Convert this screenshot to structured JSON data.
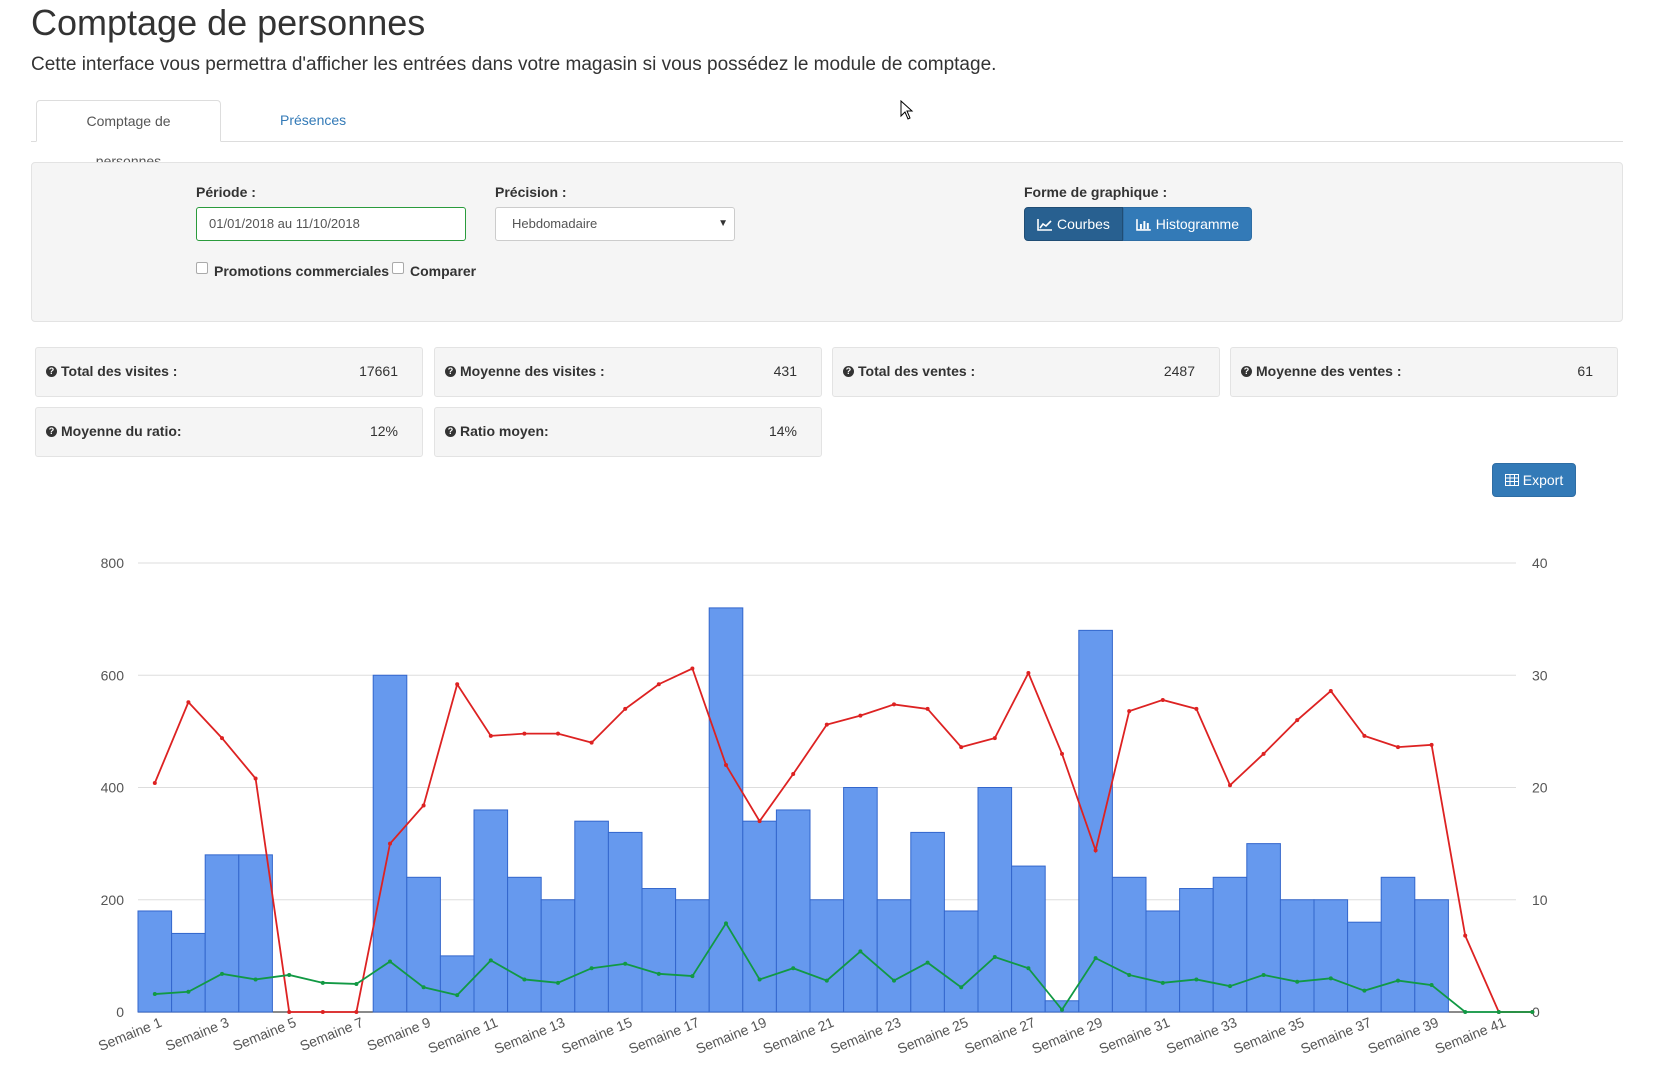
{
  "header": {
    "title": "Comptage de personnes",
    "description": "Cette interface vous permettra d'afficher les entrées dans votre magasin si vous possédez le module de comptage."
  },
  "tabs": [
    {
      "label": "Comptage de personnes",
      "active": true
    },
    {
      "label": "Présences",
      "active": false
    }
  ],
  "filters": {
    "period_label": "Période :",
    "period_value": "01/01/2018 au 11/10/2018",
    "precision_label": "Précision :",
    "precision_value": "Hebdomadaire",
    "chart_form_label": "Forme de graphique :",
    "btn_curves": "Courbes",
    "btn_histogram": "Histogramme",
    "chk_promotions": "Promotions commerciales",
    "chk_compare": "Comparer"
  },
  "stats": [
    {
      "label": "Total des visites :",
      "value": "17661"
    },
    {
      "label": "Moyenne des visites :",
      "value": "431"
    },
    {
      "label": "Total des ventes :",
      "value": "2487"
    },
    {
      "label": "Moyenne des ventes :",
      "value": "61"
    },
    {
      "label": "Moyenne du ratio:",
      "value": "12%"
    },
    {
      "label": "Ratio moyen:",
      "value": "14%"
    }
  ],
  "export_label": "Export",
  "colors": {
    "bars": "#6699ee",
    "bar_border": "#3366cc",
    "red_line": "#dd2222",
    "green_line": "#119944",
    "primary": "#337ab7",
    "primary_dark": "#286090"
  },
  "chart_data": {
    "type": "bar",
    "categories": [
      "Semaine 1",
      "Semaine 2",
      "Semaine 3",
      "Semaine 4",
      "Semaine 5",
      "Semaine 6",
      "Semaine 7",
      "Semaine 8",
      "Semaine 9",
      "Semaine 10",
      "Semaine 11",
      "Semaine 12",
      "Semaine 13",
      "Semaine 14",
      "Semaine 15",
      "Semaine 16",
      "Semaine 17",
      "Semaine 18",
      "Semaine 19",
      "Semaine 20",
      "Semaine 21",
      "Semaine 22",
      "Semaine 23",
      "Semaine 24",
      "Semaine 25",
      "Semaine 26",
      "Semaine 27",
      "Semaine 28",
      "Semaine 29",
      "Semaine 30",
      "Semaine 31",
      "Semaine 32",
      "Semaine 33",
      "Semaine 34",
      "Semaine 35",
      "Semaine 36",
      "Semaine 37",
      "Semaine 38",
      "Semaine 39",
      "Semaine 40",
      "Semaine 41",
      "Semaine 42"
    ],
    "tick_labels": [
      "Semaine 1",
      "Semaine 3",
      "Semaine 5",
      "Semaine 7",
      "Semaine 9",
      "Semaine 11",
      "Semaine 13",
      "Semaine 15",
      "Semaine 17",
      "Semaine 19",
      "Semaine 21",
      "Semaine 23",
      "Semaine 25",
      "Semaine 27",
      "Semaine 29",
      "Semaine 31",
      "Semaine 33",
      "Semaine 35",
      "Semaine 37",
      "Semaine 39",
      "Semaine 41"
    ],
    "ylim_left": [
      0,
      800
    ],
    "yticks_left": [
      0,
      200,
      400,
      600,
      800
    ],
    "ylim_right": [
      0,
      40
    ],
    "yticks_right": [
      0,
      10,
      20,
      30,
      40
    ],
    "grid": true,
    "series": [
      {
        "type": "bar",
        "axis": "left",
        "values": [
          180,
          140,
          280,
          280,
          0,
          0,
          0,
          600,
          240,
          100,
          360,
          240,
          200,
          340,
          320,
          220,
          200,
          720,
          340,
          360,
          200,
          400,
          200,
          320,
          180,
          400,
          260,
          20,
          680,
          240,
          180,
          220,
          240,
          300,
          200,
          200,
          160,
          240,
          200,
          0,
          0,
          0
        ]
      },
      {
        "type": "line",
        "axis": "right",
        "values": [
          20.4,
          27.6,
          24.4,
          20.8,
          0,
          0,
          0,
          15,
          18.4,
          29.2,
          24.6,
          24.8,
          24.8,
          24,
          27,
          29.2,
          30.6,
          22,
          17,
          21.2,
          25.6,
          26.4,
          27.4,
          27,
          23.6,
          24.4,
          30.2,
          23,
          14.4,
          26.8,
          27.8,
          27,
          20.2,
          23,
          26,
          28.6,
          24.6,
          23.6,
          23.8,
          6.8,
          0,
          0
        ]
      },
      {
        "type": "line",
        "axis": "right",
        "values": [
          1.6,
          1.8,
          3.4,
          2.9,
          3.3,
          2.6,
          2.5,
          4.5,
          2.2,
          1.5,
          4.6,
          2.9,
          2.6,
          3.9,
          4.3,
          3.4,
          3.2,
          7.9,
          2.9,
          3.9,
          2.8,
          5.4,
          2.8,
          4.4,
          2.2,
          4.9,
          3.9,
          0.2,
          4.8,
          3.3,
          2.6,
          2.9,
          2.3,
          3.3,
          2.7,
          3.0,
          1.9,
          2.8,
          2.4,
          0,
          0,
          0
        ]
      }
    ]
  }
}
